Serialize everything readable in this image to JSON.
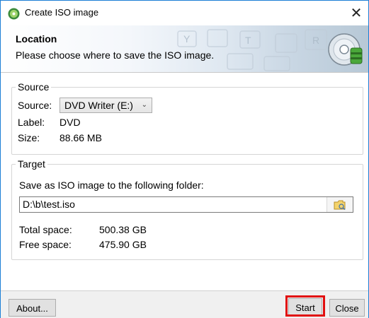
{
  "window": {
    "title": "Create ISO image",
    "close_glyph": "✕"
  },
  "header": {
    "heading": "Location",
    "subtitle": "Please choose where to save the ISO image."
  },
  "source": {
    "group_title": "Source",
    "source_label": "Source:",
    "source_value": "DVD Writer (E:)",
    "label_label": "Label:",
    "label_value": "DVD",
    "size_label": "Size:",
    "size_value": "88.66 MB"
  },
  "target": {
    "group_title": "Target",
    "prompt": "Save as ISO image to the following folder:",
    "path_value": "D:\\b\\test.iso",
    "total_label": "Total space:",
    "total_value": "500.38 GB",
    "free_label": "Free space:",
    "free_value": "475.90 GB"
  },
  "buttons": {
    "about": "About...",
    "start": "Start",
    "close": "Close"
  },
  "colors": {
    "window_border": "#1c7fd6",
    "highlight": "#e10f0f",
    "footer_bg": "#f0f0f0"
  },
  "icons": [
    "app-icon",
    "close-icon",
    "dropdown-arrow-icon",
    "folder-browse-icon",
    "disc-icon"
  ]
}
